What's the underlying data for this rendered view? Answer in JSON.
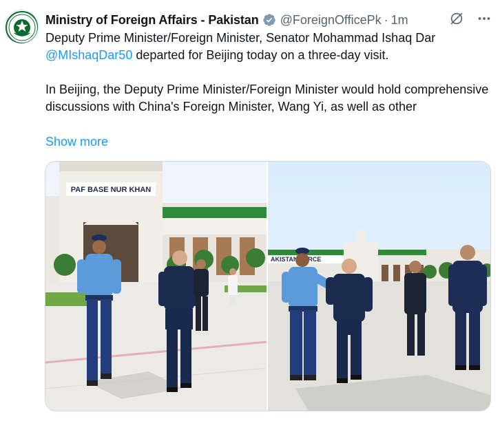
{
  "account": {
    "name": "Ministry of Foreign Affairs - Pakistan",
    "handle": "@ForeignOfficePk",
    "separator": "·",
    "time": "1m"
  },
  "icons": {
    "avatar": "ministry-seal-icon",
    "verified": "verified-badge-icon",
    "grok": "grok-icon",
    "more": "more-horizontal-icon"
  },
  "colors": {
    "accent": "#1d9bf0",
    "verified_badge": "#829aab",
    "text": "#0f1419",
    "secondary_text": "#536471"
  },
  "post": {
    "line1": "Deputy Prime Minister/Foreign Minister, Senator Mohammad Ishaq Dar",
    "mention": "@MIshaqDar50",
    "line2_rest": " departed for Beijing today on a three-day visit.",
    "paragraph2": "In Beijing, the Deputy Prime Minister/Foreign Minister would hold comprehensive discussions with China's Foreign Minister, Wang Yi, as well as other",
    "show_more": "Show more"
  },
  "media": {
    "photo1_sign": "PAF BASE NUR KHAN",
    "photo2_sign": "AKISTAN FORCE"
  }
}
